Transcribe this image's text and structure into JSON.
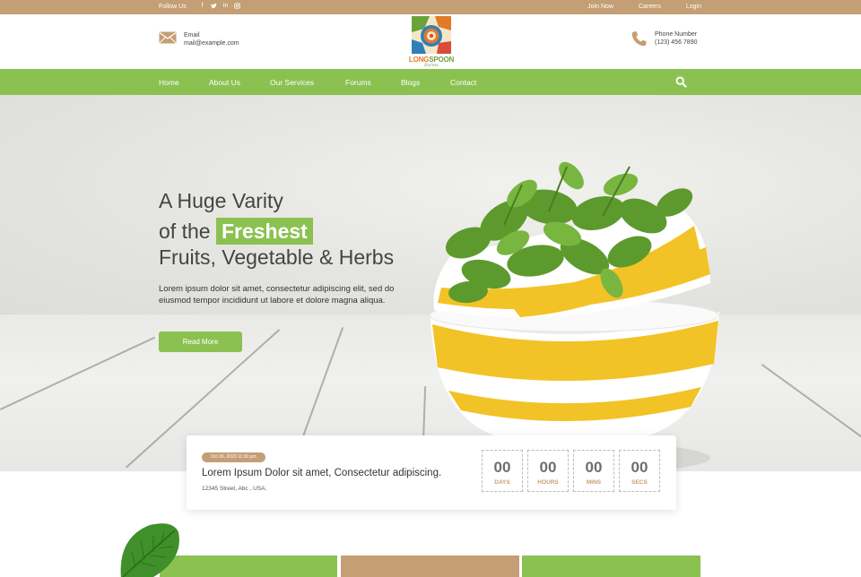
{
  "topbar": {
    "follow_label": "Follow Us",
    "socials": [
      "facebook-icon",
      "twitter-icon",
      "linkedin-icon",
      "instagram-icon"
    ],
    "links": [
      "Join Now",
      "Careers",
      "Login"
    ]
  },
  "header": {
    "email_label": "Email",
    "email_value": "mail@example.com",
    "phone_label": "Phone Number",
    "phone_value": "(123) 456 7890",
    "logo_part1": "LONG",
    "logo_part2": "SPOON",
    "logo_sub": "Farms"
  },
  "nav": {
    "items": [
      "Home",
      "About Us",
      "Our Services",
      "Forums",
      "Blogs",
      "Contact"
    ],
    "search_icon": "search-icon"
  },
  "hero": {
    "line1": "A Huge Varity",
    "line2_prefix": "of the",
    "line2_highlight": "Freshest",
    "line3": "Fruits, Vegetable & Herbs",
    "description": "Lorem ipsum dolor sit amet, consectetur adipiscing elit, sed do eiusmod tempor incididunt ut labore et dolore magna aliqua.",
    "button_label": "Read More"
  },
  "event": {
    "date": "Oct 26, 2023 11:30 pm",
    "title": "Lorem Ipsum Dolor sit amet, Consectetur adipiscing.",
    "address": "12345 Street, Abc , USA.",
    "countdown": [
      {
        "value": "00",
        "unit": "DAYS"
      },
      {
        "value": "00",
        "unit": "HOURS"
      },
      {
        "value": "00",
        "unit": "MINS"
      },
      {
        "value": "00",
        "unit": "SECS"
      }
    ]
  },
  "colors": {
    "brand_green": "#8bc151",
    "brand_tan": "#c49e74"
  }
}
